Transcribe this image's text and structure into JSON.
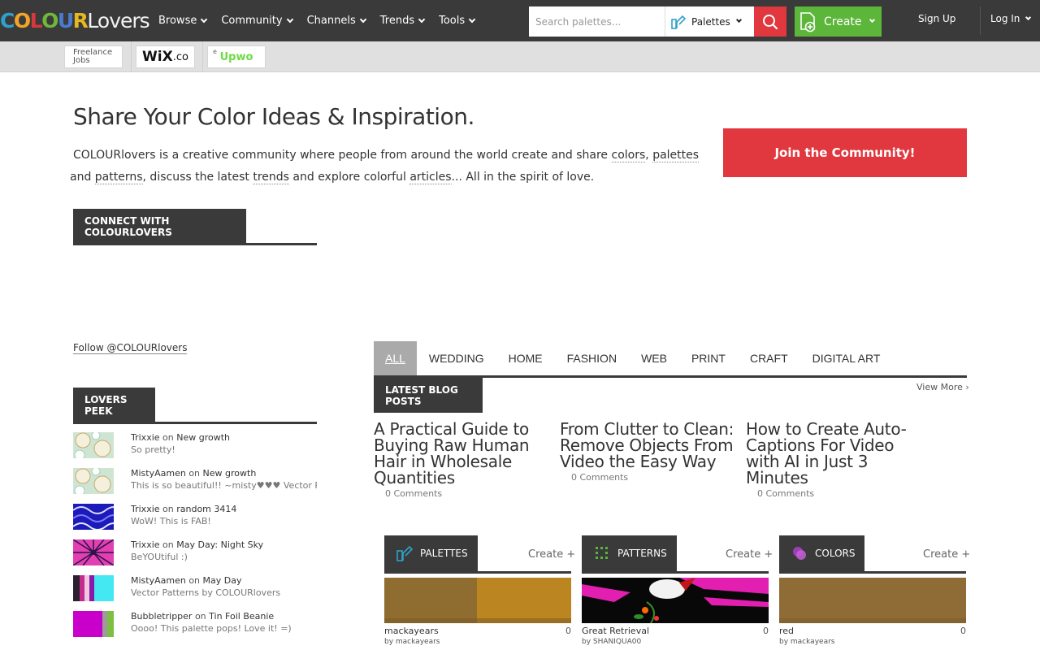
{
  "header": {
    "logo": {
      "letters": [
        "C",
        "O",
        "L",
        "O",
        "U",
        "R"
      ],
      "colors": [
        "#2ea1c9",
        "#f2a429",
        "#d7383f",
        "#6fb73b",
        "#4a7bd0",
        "#e6b820"
      ],
      "suffix": "Lovers"
    },
    "nav": [
      "Browse",
      "Community",
      "Channels",
      "Trends",
      "Tools"
    ],
    "search": {
      "placeholder": "Search palettes...",
      "type_label": "Palettes"
    },
    "create_label": "Create",
    "signup_label": "Sign Up",
    "login_label": "Log In"
  },
  "sponsors": {
    "freelance_line1": "Freelance",
    "freelance_line2": "Jobs",
    "wix": "WiX",
    "wix_suffix": ".co",
    "upwork_prefix": "e",
    "upwork": "Upwo"
  },
  "hero": {
    "title": "Share Your Color Ideas & Inspiration.",
    "text_1": "COLOURlovers is a creative community where people from around the world create and share ",
    "link_colors": "colors",
    "comma_1": ", ",
    "link_palettes": "palettes",
    "and_1": " and ",
    "link_patterns": "patterns",
    "text_2": ", discuss the latest ",
    "link_trends": "trends",
    "text_3": " and explore colorful ",
    "link_articles": "articles",
    "text_4": "... All in the spirit of love.",
    "join_label": "Join the Community!"
  },
  "connect_label": "CONNECT WITH COLOURLOVERS",
  "follow_label": "Follow @COLOURlovers",
  "lovers_peek": {
    "title": "LOVERS PEEK",
    "on": " on ",
    "items": [
      {
        "user": "Trixxie",
        "target": "New growth",
        "comment": "So pretty!"
      },
      {
        "user": "MistyAamen",
        "target": "New growth",
        "comment": "This is so beautiful!! ~misty♥♥♥ Vector Patterns"
      },
      {
        "user": "Trixxie",
        "target": "random 3414",
        "comment": "WoW! This is FAB!"
      },
      {
        "user": "Trixxie",
        "target": "May Day: Night Sky",
        "comment": "BeYOUtiful :)"
      },
      {
        "user": "MistyAamen",
        "target": "May Day",
        "comment": "Vector Patterns by COLOURlovers"
      },
      {
        "user": "Bubbletripper",
        "target": "Tin Foil Beanie",
        "comment": "Oooo! This palette pops! Love it! =)"
      }
    ]
  },
  "categories": [
    "ALL",
    "WEDDING",
    "HOME",
    "FASHION",
    "WEB",
    "PRINT",
    "CRAFT",
    "DIGITAL ART"
  ],
  "blog": {
    "title": "LATEST BLOG POSTS",
    "view_more": "View More ›",
    "posts": [
      {
        "title": "A Practical Guide to Buying Raw Human Hair in Wholesale Quantities",
        "comments": "0 Comments"
      },
      {
        "title": "From Clutter to Clean: Remove Objects From Video the Easy Way",
        "comments": "0 Comments"
      },
      {
        "title": "How to Create Auto-Captions For Video with AI in Just 3 Minutes",
        "comments": "0 Comments"
      }
    ]
  },
  "modules": [
    {
      "title": "PALETTES",
      "create": "Create +",
      "item": "mackayears",
      "count": "0",
      "by": "by mackayears",
      "colors": [
        "#8f6c30",
        "#bb8521"
      ]
    },
    {
      "title": "PATTERNS",
      "create": "Create +",
      "item": "Great Retrieval",
      "count": "0",
      "by": "by SHANIQUA00"
    },
    {
      "title": "COLORS",
      "create": "Create +",
      "item": "red",
      "count": "0",
      "by": "by mackayears",
      "colors": [
        "#8f6c35"
      ]
    }
  ],
  "accent": {
    "red": "#e0383e",
    "green": "#5cb63a",
    "dark": "#3a3a3a"
  }
}
